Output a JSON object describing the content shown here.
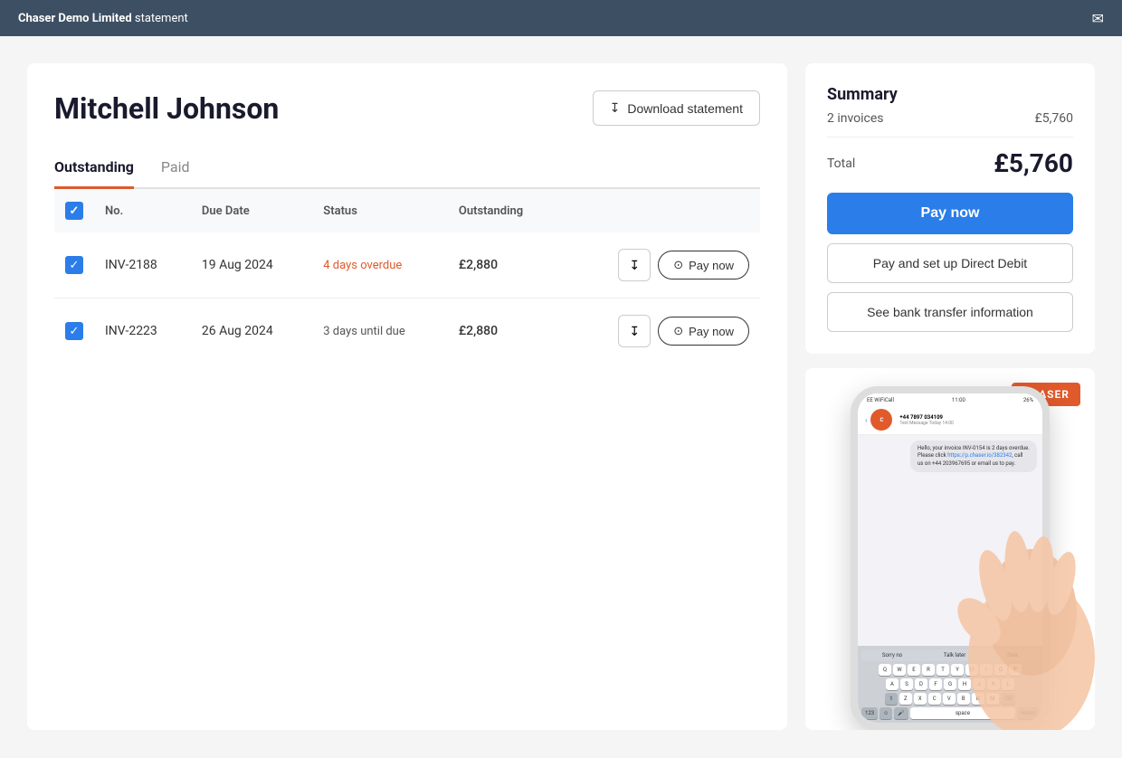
{
  "topbar": {
    "title_normal": "Chaser Demo Limited",
    "title_bold": "Chaser Demo Limited",
    "title_rest": " statement",
    "email_icon": "✉"
  },
  "page": {
    "customer_name": "Mitchell Johnson",
    "download_btn_label": "Download statement",
    "tabs": [
      {
        "id": "outstanding",
        "label": "Outstanding",
        "active": true
      },
      {
        "id": "paid",
        "label": "Paid",
        "active": false
      }
    ]
  },
  "table": {
    "columns": [
      "No.",
      "Due Date",
      "Status",
      "Outstanding"
    ],
    "rows": [
      {
        "id": "row-inv2188",
        "checked": true,
        "number": "INV-2188",
        "due_date": "19 Aug 2024",
        "status": "4 days overdue",
        "status_type": "overdue",
        "outstanding": "£2,880",
        "pay_label": "Pay now"
      },
      {
        "id": "row-inv2223",
        "checked": true,
        "number": "INV-2223",
        "due_date": "26 Aug 2024",
        "status": "3 days until due",
        "status_type": "upcoming",
        "outstanding": "£2,880",
        "pay_label": "Pay now"
      }
    ]
  },
  "summary": {
    "title": "Summary",
    "invoices_count": "2 invoices",
    "invoices_amount": "£5,760",
    "total_label": "Total",
    "total_amount": "£5,760",
    "pay_now_label": "Pay now",
    "direct_debit_label": "Pay and set up Direct Debit",
    "bank_info_label": "See bank transfer information"
  },
  "phone": {
    "time": "11:00",
    "battery": "26%",
    "carrier": "EE WiFiCall",
    "contact_number": "+44 7897 034109",
    "date_label": "Text Message Today 14:00",
    "message": "Hello, your invoice INV-0154 is 2 days overdue. Please click https://p.chaser.io/382342, call us on +44 203967695 or email us to pay.",
    "link_text": "https://p.chaser.io/382342",
    "suggestions": [
      "Sorry no",
      "Talk later",
      "Sure"
    ],
    "keyboard_rows": [
      [
        "Q",
        "W",
        "E",
        "R",
        "T",
        "Y",
        "U",
        "I",
        "O",
        "P"
      ],
      [
        "A",
        "S",
        "D",
        "F",
        "G",
        "H",
        "J",
        "K",
        "L"
      ],
      [
        "Z",
        "X",
        "C",
        "V",
        "B",
        "N",
        "M"
      ]
    ]
  },
  "chaser_logo": "CHASER"
}
